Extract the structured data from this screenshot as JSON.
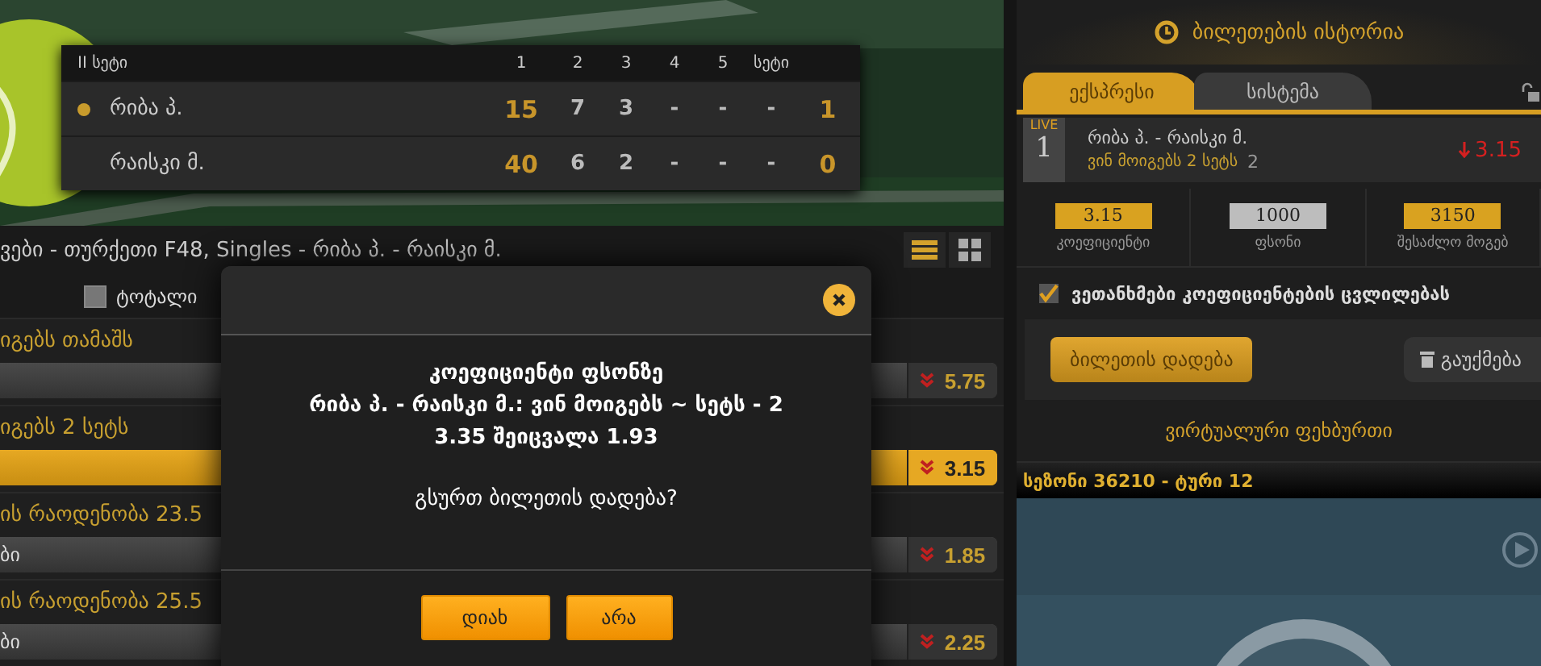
{
  "scoreboard": {
    "columns": [
      "II სეტი",
      "1",
      "2",
      "3",
      "4",
      "5",
      "სეტი"
    ],
    "players": [
      {
        "name": "რიბა პ.",
        "serving": true,
        "points": "15",
        "sets": [
          "7",
          "3",
          "-",
          "-",
          "-"
        ],
        "total": "1"
      },
      {
        "name": "რაისკი მ.",
        "serving": false,
        "points": "40",
        "sets": [
          "6",
          "2",
          "-",
          "-",
          "-"
        ],
        "total": "0"
      }
    ]
  },
  "event_title": "ვები - თურქეთი F48, Singles - რიბა პ. - რაისკი მ.",
  "view_toggle": [
    {
      "kind": "list",
      "selected": true
    },
    {
      "kind": "grid",
      "selected": false
    }
  ],
  "filter": {
    "label": "ტოტალი",
    "checked": false
  },
  "markets": [
    {
      "title": "იგებს თამაშს",
      "outcome": {
        "odds": "5.75",
        "selected": false
      }
    },
    {
      "title": "იგებს 2 სეტს",
      "outcome": {
        "odds": "3.15",
        "selected": true
      }
    },
    {
      "title": "ის რაოდენობა 23.5",
      "outcome": {
        "label": "ბი",
        "odds": "1.85",
        "selected": false
      }
    },
    {
      "title": "ის რაოდენობა 25.5",
      "outcome": {
        "label": "ბი",
        "odds": "2.25",
        "selected": false
      }
    }
  ],
  "dialog": {
    "lines": [
      "კოეფიციენტი ფსონზე",
      "რიბა პ. - რაისკი მ.: ვინ მოიგებს ~ სეტს - 2",
      "3.35 შეიცვალა 1.93"
    ],
    "question": "გსურთ ბილეთის დადება?",
    "buttons": [
      "დიახ",
      "არა"
    ]
  },
  "history_title": "ბილეთების ისტორია",
  "tabs": [
    {
      "label": "ექსპრესი",
      "selected": true
    },
    {
      "label": "სისტემა",
      "selected": false
    }
  ],
  "bet": {
    "badge": "LIVE",
    "number": "1",
    "match": "რიბა პ. - რაისკი მ.",
    "market": "ვინ მოიგებს 2 სეტს",
    "pick": "2",
    "odds": "3.15"
  },
  "summary": [
    {
      "value": "3.15",
      "label": "კოეფიციენტი",
      "kind": "gold"
    },
    {
      "value": "1000",
      "label": "ფსონი",
      "kind": "input"
    },
    {
      "value": "3150",
      "label": "შესაძლო მოგებ",
      "kind": "gold"
    }
  ],
  "accept_changes": {
    "label": "ვეთანხმები კოეფიციენტების ცვლილებას",
    "checked": true
  },
  "place_button": "ბილეთის დადება",
  "cancel_button": "გაუქმება",
  "virtual_title": "ვირტუალური ფეხბურთი",
  "season": "სეზონი 36210 - ტური 12"
}
